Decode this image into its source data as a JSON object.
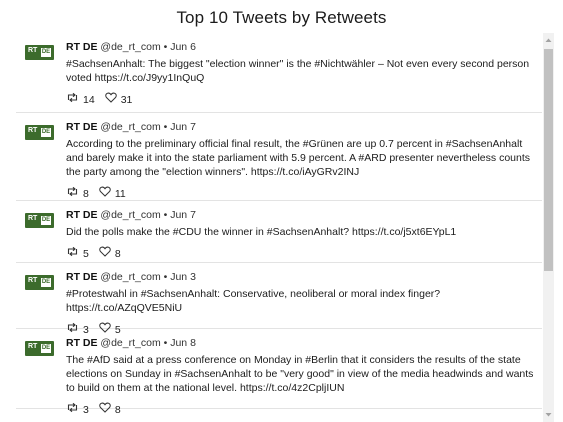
{
  "title": "Top 10 Tweets by Retweets",
  "avatar": {
    "rt": "RT",
    "de": "DE"
  },
  "tweets": [
    {
      "name": "RT DE",
      "handle": "@de_rt_com",
      "date": "Jun 6",
      "text": "#SachsenAnhalt: The biggest \"election winner\" is the #Nichtwähler – Not even every second person voted https://t.co/J9yy1InQuQ",
      "retweets": "14",
      "likes": "31"
    },
    {
      "name": "RT DE",
      "handle": "@de_rt_com",
      "date": "Jun 7",
      "text": "According to the preliminary official final result, the #Grünen are up 0.7 percent in #SachsenAnhalt and barely make it into the state parliament with 5.9 percent. A #ARD presenter nevertheless counts the party among the \"election winners\". https://t.co/iAyGRv2INJ",
      "retweets": "8",
      "likes": "11"
    },
    {
      "name": "RT DE",
      "handle": "@de_rt_com",
      "date": "Jun 7",
      "text": "Did the polls make the #CDU the winner in #SachsenAnhalt? https://t.co/j5xt6EYpL1",
      "retweets": "5",
      "likes": "8"
    },
    {
      "name": "RT DE",
      "handle": "@de_rt_com",
      "date": "Jun 3",
      "text": "#Protestwahl in #SachsenAnhalt: Conservative, neoliberal or moral index finger? https://t.co/AZqQVE5NiU",
      "retweets": "3",
      "likes": "5"
    },
    {
      "name": "RT DE",
      "handle": "@de_rt_com",
      "date": "Jun 8",
      "text": "The #AfD said at a press conference on Monday in #Berlin that it considers the results of the state elections on Sunday in #SachsenAnhalt to be \"very good\" in view of the media headwinds and wants to build on them at the national level. https://t.co/4z2CpljIUN",
      "retweets": "3",
      "likes": "8"
    }
  ]
}
